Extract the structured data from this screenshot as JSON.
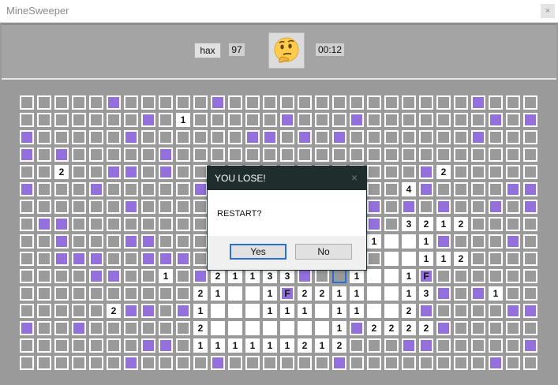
{
  "window": {
    "title": "MineSweeper",
    "close_glyph": "×"
  },
  "header": {
    "hax_label": "hax",
    "mines_remaining": "97",
    "face_icon": "thinking-face-icon",
    "timer": "00:12"
  },
  "colors": {
    "mine": "#9370db",
    "unrevealed": "#9a9a9a",
    "revealed": "#ffffff",
    "dialog_title_bg": "#1f2d2d"
  },
  "board": {
    "rows": 16,
    "cols": 30,
    "legend": {
      "#": "unrevealed",
      "M": "mine",
      ".": "revealed-empty",
      "F": "flag",
      "1-8": "revealed-number",
      "S": "selected-unrevealed"
    },
    "grid": [
      "#####M#####M##############M###",
      "#######M#1#####M###M#######M#M",
      "M#####M######MM#M#M#######M###",
      "M#M#####M#####################",
      "##2##MM#M#####M##M#####M2#####",
      "M###M#####M###########4M####MM",
      "######M#############M#M#M##M#M",
      "#MM#########M##M##M#M#3212####",
      "##M###MM############1..1M###M#",
      "##MMM##MMM#######MM##..112####",
      "####MM##1#M21133M#S1..1F######",
      "##########21..1F2211..13M#M1##",
      "#####2MM#M1...111.11..2M####MM",
      "M##M######2.......1M2222M#####",
      "#######MM#111111212###MM#####M",
      "######M####M######M########M##"
    ]
  },
  "dialog": {
    "title": "YOU LOSE!",
    "close_glyph": "×",
    "message": "RESTART?",
    "yes_label": "Yes",
    "no_label": "No"
  }
}
